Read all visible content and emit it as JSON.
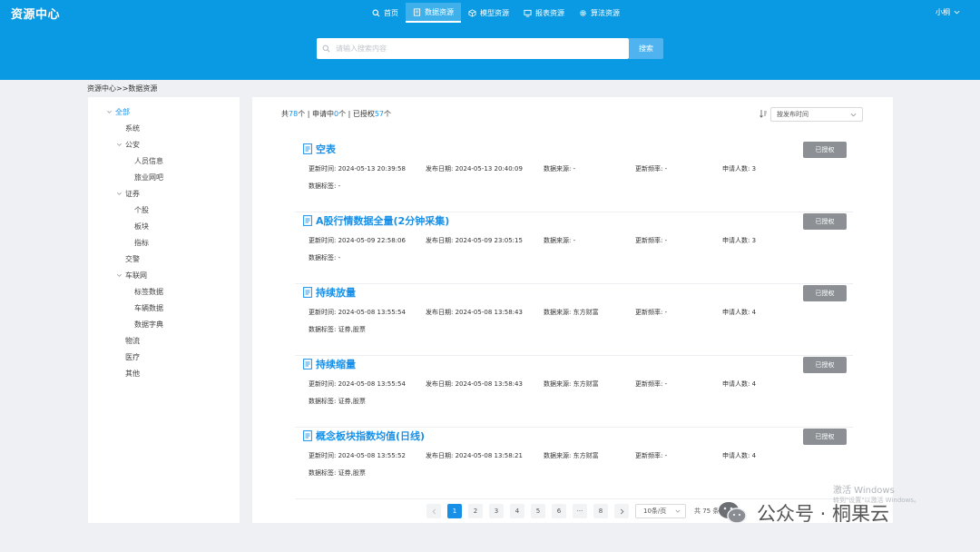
{
  "app": {
    "title": "资源中心"
  },
  "nav": [
    {
      "label": "首页",
      "icon": "search-icon"
    },
    {
      "label": "数据资源",
      "icon": "document-icon"
    },
    {
      "label": "模型资源",
      "icon": "cube-icon"
    },
    {
      "label": "报表资源",
      "icon": "monitor-icon"
    },
    {
      "label": "算法资源",
      "icon": "gear-icon"
    }
  ],
  "user": {
    "name": "小桐"
  },
  "search": {
    "placeholder": "请输入搜索内容",
    "button": "搜索"
  },
  "breadcrumb": "资源中心>>数据资源",
  "tree": [
    {
      "label": "全部",
      "expanded": true,
      "selected": true
    },
    {
      "label": "系统"
    },
    {
      "label": "公安",
      "expanded": true
    },
    {
      "label": "人员信息"
    },
    {
      "label": "旅业网吧"
    },
    {
      "label": "证券",
      "expanded": true
    },
    {
      "label": "个股"
    },
    {
      "label": "板块"
    },
    {
      "label": "指标"
    },
    {
      "label": "交警"
    },
    {
      "label": "车联网",
      "expanded": true
    },
    {
      "label": "标签数据"
    },
    {
      "label": "车辆数据"
    },
    {
      "label": "数据字典"
    },
    {
      "label": "物流"
    },
    {
      "label": "医疗"
    },
    {
      "label": "其他"
    }
  ],
  "summary": {
    "prefix": "共",
    "total": "78",
    "applying_label": "个 | 申请中",
    "applying": "0",
    "authorized_label": "个 | 已授权",
    "authorized": "57",
    "suffix": "个"
  },
  "sort": {
    "selected": "按发布时间"
  },
  "labels": {
    "updated": "更新时间:",
    "published": "发布日期:",
    "source": "数据来源:",
    "frequency": "更新频率:",
    "applicants": "申请人数:",
    "tags": "数据标签:"
  },
  "resources": [
    {
      "title": "空表",
      "button": "已授权",
      "updated": "2024-05-13 20:39:58",
      "published": "2024-05-13 20:40:09",
      "source": "-",
      "frequency": "-",
      "applicants": "3",
      "tags": "-"
    },
    {
      "title": "A股行情数据全量(2分钟采集)",
      "button": "已授权",
      "updated": "2024-05-09 22:58:06",
      "published": "2024-05-09 23:05:15",
      "source": "-",
      "frequency": "-",
      "applicants": "3",
      "tags": "-"
    },
    {
      "title": "持续放量",
      "button": "已授权",
      "updated": "2024-05-08 13:55:54",
      "published": "2024-05-08 13:58:43",
      "source": "东方财富",
      "frequency": "-",
      "applicants": "4",
      "tags": "证券,股票"
    },
    {
      "title": "持续缩量",
      "button": "已授权",
      "updated": "2024-05-08 13:55:54",
      "published": "2024-05-08 13:58:43",
      "source": "东方财富",
      "frequency": "-",
      "applicants": "4",
      "tags": "证券,股票"
    },
    {
      "title": "概念板块指数均值(日线)",
      "button": "已授权",
      "updated": "2024-05-08 13:55:52",
      "published": "2024-05-08 13:58:21",
      "source": "东方财富",
      "frequency": "-",
      "applicants": "4",
      "tags": "证券,股票"
    }
  ],
  "pagination": {
    "pages": [
      "1",
      "2",
      "3",
      "4",
      "5",
      "6",
      "···",
      "8"
    ],
    "current": "1",
    "page_size": "10条/页",
    "total": "共 75 条"
  },
  "overlay": {
    "activate_title": "激活 Windows",
    "activate_sub": "转到\"设置\"以激活 Windows。",
    "watermark": "公众号 · 桐果云"
  },
  "colors": {
    "header": "#0a9ae3",
    "accent": "#1890e8",
    "authorized_button": "#8c9095"
  }
}
